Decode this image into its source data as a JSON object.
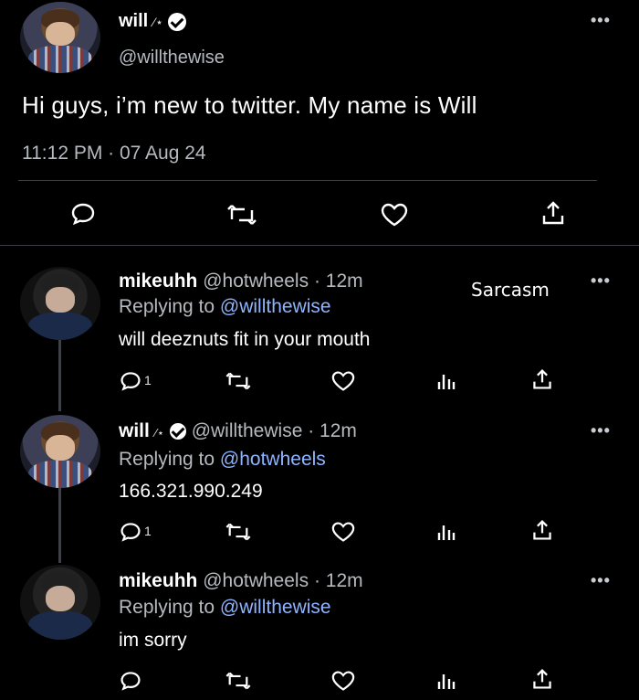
{
  "main_post": {
    "name": "will",
    "wand": "⁄⋆",
    "handle": "@willthewise",
    "text": "Hi guys, i’m new to twitter. My name is Will",
    "time": "11:12 PM · 07 Aug 24",
    "more": "•••"
  },
  "overlay": {
    "sarcasm_label": "Sarcasm"
  },
  "replies": [
    {
      "name": "mikeuhh",
      "handle": "@hotwheels",
      "time": "· 12m",
      "replying_label": "Replying to",
      "replying_handle": "@willthewise",
      "text": "will deeznuts fit in your mouth",
      "reply_count": "1",
      "more": "•••"
    },
    {
      "name": "will",
      "wand": "⁄⋆",
      "handle": "@willthewise",
      "time": "· 12m",
      "replying_label": "Replying to",
      "replying_handle": "@hotwheels",
      "text": "166.321.990.249",
      "reply_count": "1",
      "more": "•••"
    },
    {
      "name": "mikeuhh",
      "handle": "@hotwheels",
      "time": "· 12m",
      "replying_label": "Replying to",
      "replying_handle": "@willthewise",
      "text": "im sorry",
      "more": "•••"
    }
  ],
  "colors": {
    "background": "#000000",
    "link_blue": "#8fb4ff",
    "secondary_text": "#b6babf"
  },
  "icons": [
    "reply-icon",
    "retweet-icon",
    "like-icon",
    "views-icon",
    "share-icon"
  ]
}
